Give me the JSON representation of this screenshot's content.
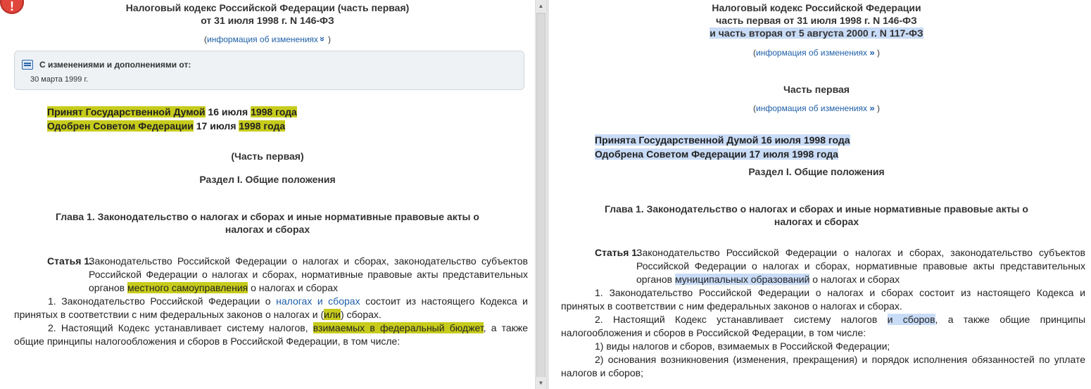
{
  "left": {
    "title_line1": "Налоговый кодекс Российской Федерации (часть первая)",
    "title_line2": "от 31 июля 1998 г. N 146-ФЗ",
    "info_open": "(",
    "info_link": "информация об изменениях",
    "info_chevron": "»",
    "info_close": ")",
    "changes_label": "С изменениями и дополнениями от:",
    "changes_date": "30 марта 1999 г.",
    "adopt_hl1": "Принят Государственной Думой",
    "adopt_rest1a": " 16 июля ",
    "adopt_hl1b": "1998 года",
    "adopt_hl2": "Одобрен Советом Федерации",
    "adopt_rest2a": " 17 июля ",
    "adopt_hl2b": "1998 года",
    "part": "(Часть первая)",
    "section": "Раздел I. Общие положения",
    "chapter_line1": "Глава 1. Законодательство о налогах и сборах и иные нормативные правовые акты о",
    "chapter_line2": "налогах и сборах",
    "art_label": "Статья 1.",
    "art_title_a": "Законодательство Российской Федерации о налогах и сборах, законодательство субъектов Российской Федерации о налогах и сборах, нормативные правовые акты представительных органов ",
    "art_title_hl": "местного самоуправления",
    "art_title_b": " о налогах и сборах",
    "p1_a": "1. Законодательство Российской Федерации о ",
    "p1_link": "налогах и сборах",
    "p1_b": " состоит из настоящего Кодекса и принятых в соответствии с ним федеральных законов о налогах и (",
    "p1_hl": "или",
    "p1_c": ") сборах.",
    "p2_a": "2. Настоящий Кодекс устанавливает систему налогов, ",
    "p2_hl": "взимаемых в федеральный бюджет",
    "p2_b": ", а также общие принципы налогообложения и сборов в Российской Федерации, в том числе:"
  },
  "right": {
    "title_line1": "Налоговый кодекс Российской Федерации",
    "title_line2": "часть первая от 31 июля 1998 г. N 146-ФЗ",
    "title_line3": "и часть вторая от 5 августа 2000 г. N 117-ФЗ",
    "info_open": "(",
    "info_link": "информация об изменениях",
    "info_chevron": "»",
    "info_close": ")",
    "part": "Часть первая",
    "adopt1": "Принята Государственной Думой 16 июля 1998 года",
    "adopt2": "Одобрена Советом Федерации 17 июля 1998 года",
    "section": "Раздел I. Общие положения",
    "chapter_line1": "Глава 1. Законодательство о налогах и сборах и иные нормативные правовые акты о",
    "chapter_line2": "налогах и сборах",
    "art_label": "Статья 1.",
    "art_title_a": "Законодательство Российской Федерации о налогах и сборах, законодательство субъектов Российской Федерации о налогах и сборах, нормативные правовые акты представительных органов ",
    "art_title_hl": "муниципальных образований",
    "art_title_b": " о налогах и сборах",
    "p1": "1. Законодательство Российской Федерации о налогах и сборах состоит из настоящего Кодекса и принятых в соответствии с ним федеральных законов о налогах и сборах.",
    "p2_a": "2. Настоящий Кодекс устанавливает систему налогов ",
    "p2_hl": "и сборов",
    "p2_b": ", а также общие принципы налогообложения и сборов в Российской Федерации, в том числе:",
    "p3": "1) виды налогов и сборов, взимаемых в Российской Федерации;",
    "p4": "2) основания возникновения (изменения, прекращения) и порядок исполнения обязанностей по уплате налогов и сборов;"
  },
  "colors": {
    "highlight_yellow": "#c7cc1c",
    "highlight_blue": "#c9dcf7",
    "link": "#1f5fa8"
  }
}
